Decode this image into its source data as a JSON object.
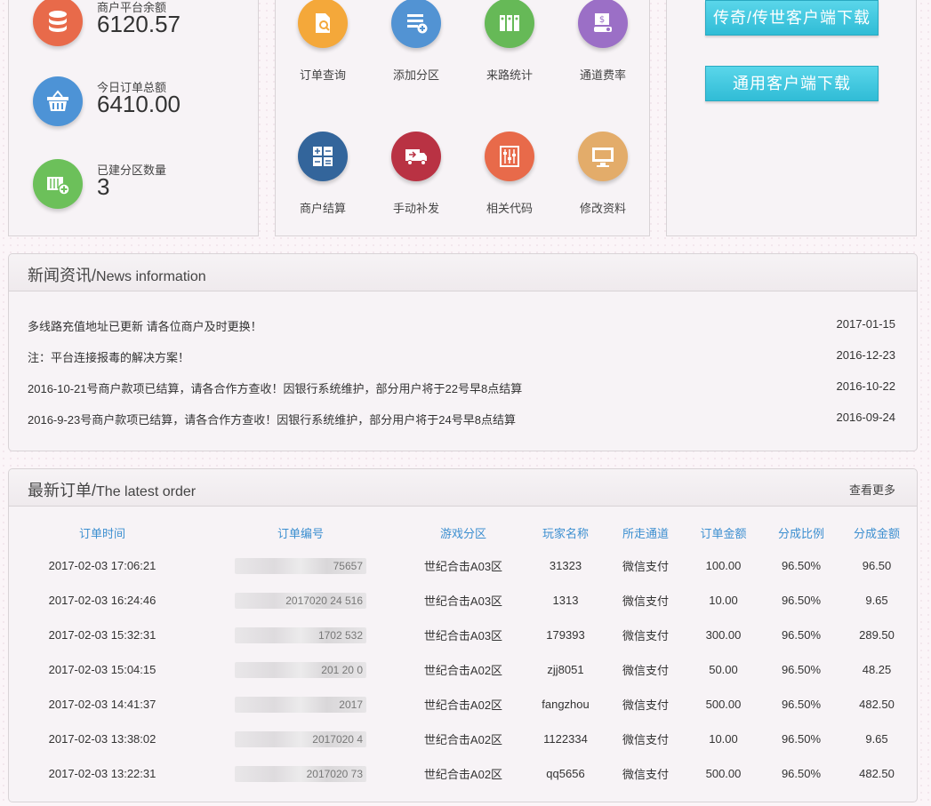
{
  "stats": [
    {
      "label": "商户平台余额",
      "value": "6120.57",
      "icon": "database-icon",
      "color": "#e86a4a"
    },
    {
      "label": "今日订单总额",
      "value": "6410.00",
      "icon": "basket-icon",
      "color": "#4d93d6"
    },
    {
      "label": "已建分区数量",
      "value": "3",
      "icon": "server-add-icon",
      "color": "#6cc05a"
    }
  ],
  "shortcuts": [
    {
      "label": "订单查询",
      "icon": "document-search-icon",
      "color": "#f4a83a"
    },
    {
      "label": "添加分区",
      "icon": "list-add-icon",
      "color": "#5293d3"
    },
    {
      "label": "来路统计",
      "icon": "columns-icon",
      "color": "#66b957"
    },
    {
      "label": "通道费率",
      "icon": "payment-icon",
      "color": "#9b6fc6"
    },
    {
      "label": "商户结算",
      "icon": "calculator-icon",
      "color": "#33659b"
    },
    {
      "label": "手动补发",
      "icon": "truck-icon",
      "color": "#b93243"
    },
    {
      "label": "相关代码",
      "icon": "equalizer-icon",
      "color": "#e86a4a"
    },
    {
      "label": "修改资料",
      "icon": "monitor-icon",
      "color": "#e3ac6a"
    }
  ],
  "downloads": {
    "btn1": "传奇/传世客户端下载",
    "btn2": "通用客户端下载"
  },
  "news": {
    "title_cn": "新闻资讯/",
    "title_en": "News information",
    "items": [
      {
        "text": "多线路充值地址已更新 请各位商户及时更换！",
        "date": "2017-01-15"
      },
      {
        "text": "注：平台连接报毒的解决方案！",
        "date": "2016-12-23"
      },
      {
        "text": "2016-10-21号商户款项已结算，请各合作方查收！因银行系统维护，部分用户将于22号早8点结算",
        "date": "2016-10-22"
      },
      {
        "text": "2016-9-23号商户款项已结算，请各合作方查收！因银行系统维护，部分用户将于24号早8点结算",
        "date": "2016-09-24"
      }
    ]
  },
  "orders": {
    "title_cn": "最新订单/",
    "title_en": "The latest order",
    "more": "查看更多",
    "columns": [
      "订单时间",
      "订单编号",
      "游戏分区",
      "玩家名称",
      "所走通道",
      "订单金额",
      "分成比例",
      "分成金额"
    ],
    "rows": [
      [
        "2017-02-03 17:06:21",
        "75657",
        "世纪合击A03区",
        "31323",
        "微信支付",
        "100.00",
        "96.50%",
        "96.50"
      ],
      [
        "2017-02-03 16:24:46",
        "2017020  24   516",
        "世纪合击A03区",
        "1313",
        "微信支付",
        "10.00",
        "96.50%",
        "9.65"
      ],
      [
        "2017-02-03 15:32:31",
        "1702   532",
        "世纪合击A03区",
        "179393",
        "微信支付",
        "300.00",
        "96.50%",
        "289.50"
      ],
      [
        "2017-02-03 15:04:15",
        "201  20   0",
        "世纪合击A02区",
        "zjj8051",
        "微信支付",
        "50.00",
        "96.50%",
        "48.25"
      ],
      [
        "2017-02-03 14:41:37",
        "2017",
        "世纪合击A02区",
        "fangzhou",
        "微信支付",
        "500.00",
        "96.50%",
        "482.50"
      ],
      [
        "2017-02-03 13:38:02",
        "2017020   4",
        "世纪合击A02区",
        "1122334",
        "微信支付",
        "10.00",
        "96.50%",
        "9.65"
      ],
      [
        "2017-02-03 13:22:31",
        "2017020   73",
        "世纪合击A02区",
        "qq5656",
        "微信支付",
        "500.00",
        "96.50%",
        "482.50"
      ]
    ]
  }
}
